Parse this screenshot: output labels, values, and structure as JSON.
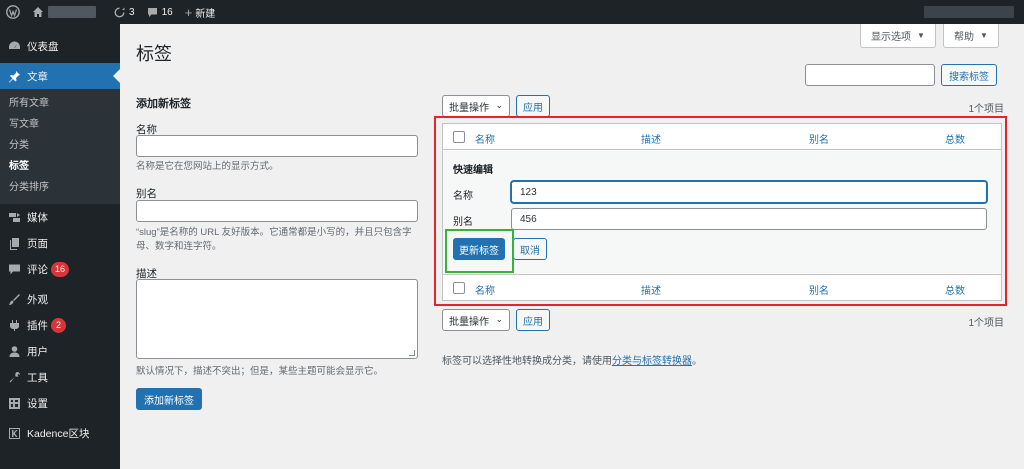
{
  "adminbar": {
    "updates_count": "3",
    "comments_count": "16",
    "new_label": "新建"
  },
  "sidebar": {
    "items": [
      {
        "label": "仪表盘",
        "icon": "dashboard-icon"
      },
      {
        "label": "文章",
        "icon": "pin-icon"
      },
      {
        "label": "媒体",
        "icon": "media-icon"
      },
      {
        "label": "页面",
        "icon": "page-icon"
      },
      {
        "label": "评论",
        "icon": "comment-icon",
        "badge": "16"
      },
      {
        "label": "外观",
        "icon": "appearance-icon"
      },
      {
        "label": "插件",
        "icon": "plugin-icon",
        "badge": "2"
      },
      {
        "label": "用户",
        "icon": "user-icon"
      },
      {
        "label": "工具",
        "icon": "tools-icon"
      },
      {
        "label": "设置",
        "icon": "settings-icon"
      },
      {
        "label": "Kadence区块",
        "icon": "kadence-icon"
      }
    ],
    "submenu": [
      "所有文章",
      "写文章",
      "分类",
      "标签",
      "分类排序"
    ]
  },
  "header": {
    "title": "标签",
    "screen_options": "显示选项",
    "help": "帮助",
    "search_button": "搜索标签"
  },
  "form": {
    "heading": "添加新标签",
    "name_label": "名称",
    "name_desc": "名称是它在您网站上的显示方式。",
    "slug_label": "别名",
    "slug_desc": "“slug”是名称的 URL 友好版本。它通常都是小写的，并且只包含字母、数字和连字符。",
    "desc_label": "描述",
    "desc_desc": "默认情况下，描述不突出；但是，某些主题可能会显示它。",
    "submit": "添加新标签"
  },
  "list": {
    "bulk_action": "批量操作",
    "apply": "应用",
    "count": "1个项目",
    "columns": [
      "名称",
      "描述",
      "别名",
      "总数"
    ],
    "quick_edit": {
      "title": "快速编辑",
      "name_label": "名称",
      "name_value": "123",
      "slug_label": "别名",
      "slug_value": "456",
      "update_button": "更新标签",
      "cancel_button": "取消"
    },
    "note_text": "标签可以选择性地转换成分类，请使用",
    "note_link": "分类与标签转换器",
    "note_end": "。"
  },
  "colors": {
    "accent": "#2271b1",
    "adminbar_bg": "#1d2327",
    "highlight_red": "#e3242b",
    "highlight_green": "#36b238"
  }
}
